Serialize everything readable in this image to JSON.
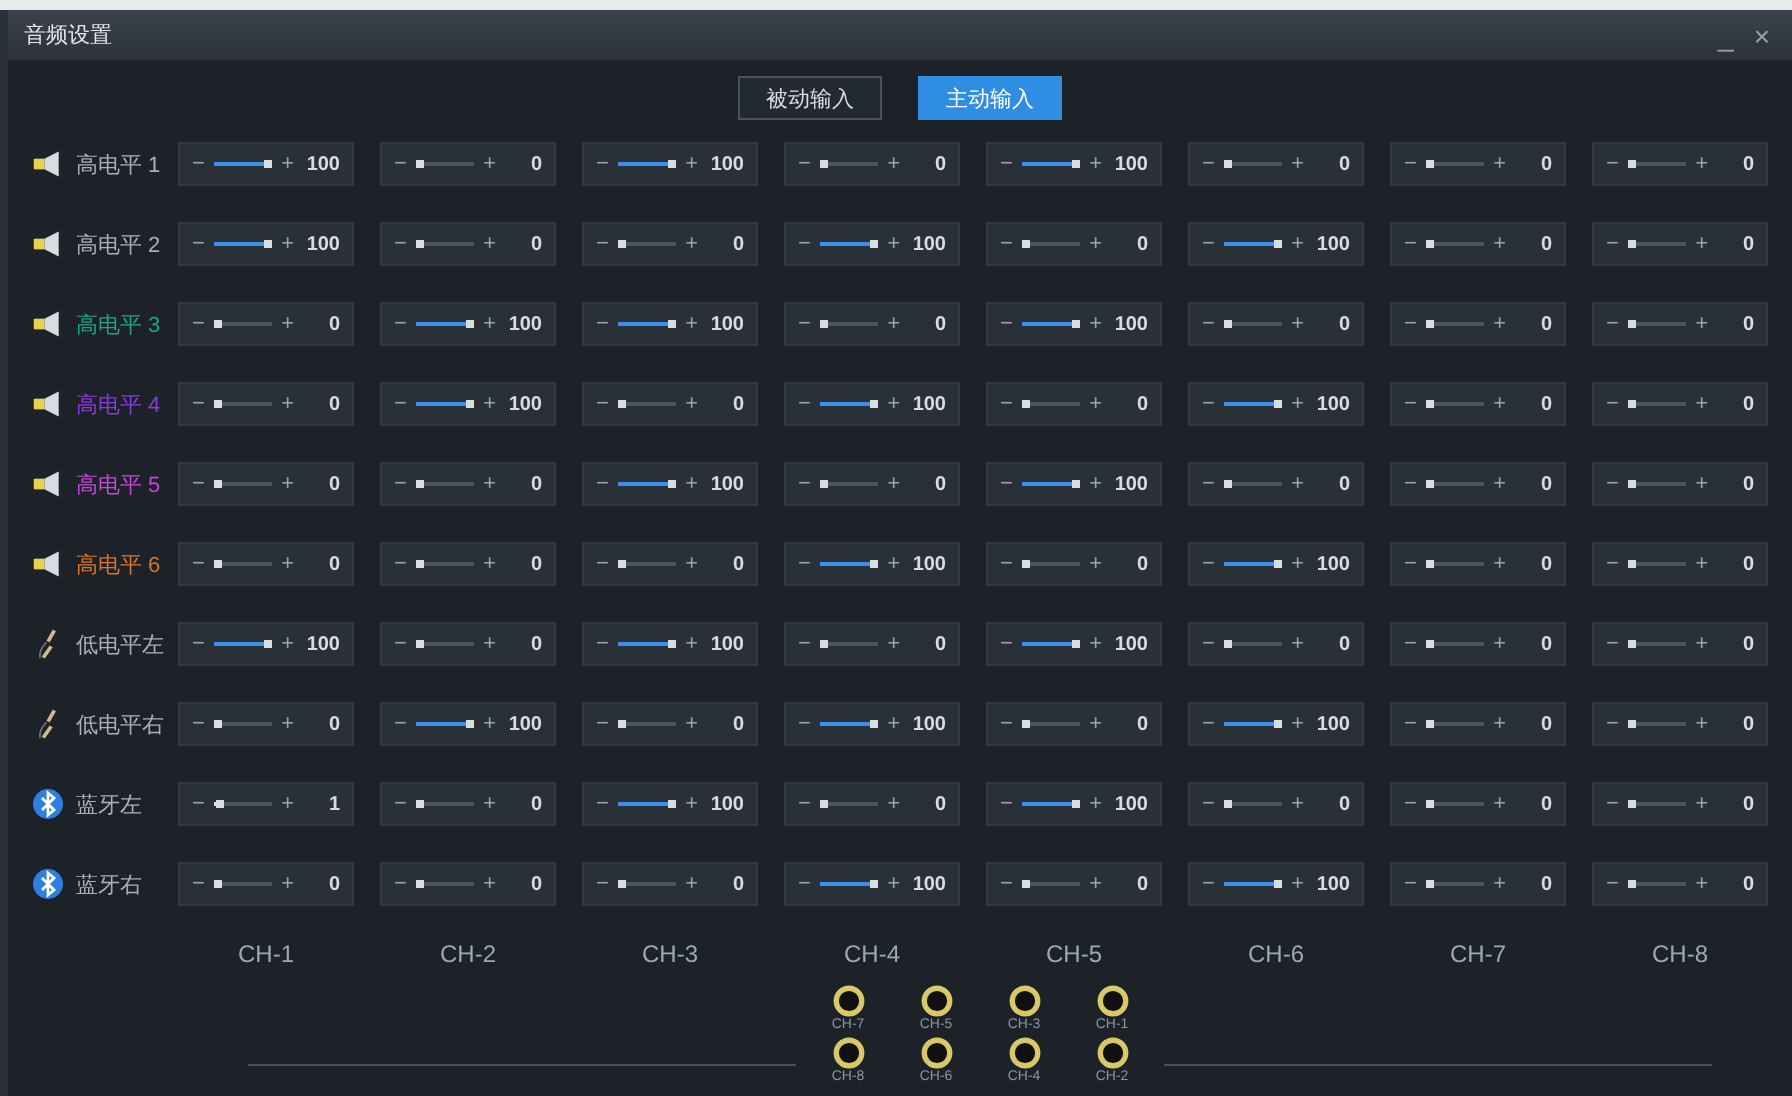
{
  "window": {
    "title": "音频设置",
    "controls": [
      "_",
      "×"
    ]
  },
  "modes": [
    {
      "label": "被动输入",
      "selected": false
    },
    {
      "label": "主动输入",
      "selected": true
    }
  ],
  "rows": [
    {
      "kind": "speaker",
      "label": "高电平 1",
      "color": "#a9b0b8",
      "cells": [
        {
          "level": 1,
          "reading": "100"
        },
        {
          "level": 0,
          "reading": "0"
        },
        {
          "level": 1,
          "reading": "100"
        },
        {
          "level": 0,
          "reading": "0"
        },
        {
          "level": 1,
          "reading": "100"
        },
        {
          "level": 0,
          "reading": "0"
        },
        {
          "level": 0,
          "reading": "0"
        },
        {
          "level": 0,
          "reading": "0"
        }
      ]
    },
    {
      "kind": "speaker",
      "label": "高电平 2",
      "color": "#a9b0b8",
      "cells": [
        {
          "level": 1,
          "reading": "100"
        },
        {
          "level": 0,
          "reading": "0"
        },
        {
          "level": 0,
          "reading": "0"
        },
        {
          "level": 1,
          "reading": "100"
        },
        {
          "level": 0,
          "reading": "0"
        },
        {
          "level": 1,
          "reading": "100"
        },
        {
          "level": 0,
          "reading": "0"
        },
        {
          "level": 0,
          "reading": "0"
        }
      ]
    },
    {
      "kind": "speaker",
      "label": "高电平 3",
      "color": "#1ea589",
      "cells": [
        {
          "level": 0,
          "reading": "0"
        },
        {
          "level": 1,
          "reading": "100"
        },
        {
          "level": 1,
          "reading": "100"
        },
        {
          "level": 0,
          "reading": "0"
        },
        {
          "level": 1,
          "reading": "100"
        },
        {
          "level": 0,
          "reading": "0"
        },
        {
          "level": 0,
          "reading": "0"
        },
        {
          "level": 0,
          "reading": "0"
        }
      ]
    },
    {
      "kind": "speaker",
      "label": "高电平 4",
      "color": "#8a3bd8",
      "cells": [
        {
          "level": 0,
          "reading": "0"
        },
        {
          "level": 1,
          "reading": "100"
        },
        {
          "level": 0,
          "reading": "0"
        },
        {
          "level": 1,
          "reading": "100"
        },
        {
          "level": 0,
          "reading": "0"
        },
        {
          "level": 1,
          "reading": "100"
        },
        {
          "level": 0,
          "reading": "0"
        },
        {
          "level": 0,
          "reading": "0"
        }
      ]
    },
    {
      "kind": "speaker",
      "label": "高电平 5",
      "color": "#c24bd6",
      "cells": [
        {
          "level": 0,
          "reading": "0"
        },
        {
          "level": 0,
          "reading": "0"
        },
        {
          "level": 1,
          "reading": "100"
        },
        {
          "level": 0,
          "reading": "0"
        },
        {
          "level": 1,
          "reading": "100"
        },
        {
          "level": 0,
          "reading": "0"
        },
        {
          "level": 0,
          "reading": "0"
        },
        {
          "level": 0,
          "reading": "0"
        }
      ]
    },
    {
      "kind": "speaker",
      "label": "高电平 6",
      "color": "#d8762c",
      "cells": [
        {
          "level": 0,
          "reading": "0"
        },
        {
          "level": 0,
          "reading": "0"
        },
        {
          "level": 0,
          "reading": "0"
        },
        {
          "level": 1,
          "reading": "100"
        },
        {
          "level": 0,
          "reading": "0"
        },
        {
          "level": 1,
          "reading": "100"
        },
        {
          "level": 0,
          "reading": "0"
        },
        {
          "level": 0,
          "reading": "0"
        }
      ]
    },
    {
      "kind": "cable",
      "label": "低电平左",
      "color": "#a9b0b8",
      "cells": [
        {
          "level": 1,
          "reading": "100"
        },
        {
          "level": 0,
          "reading": "0"
        },
        {
          "level": 1,
          "reading": "100"
        },
        {
          "level": 0,
          "reading": "0"
        },
        {
          "level": 1,
          "reading": "100"
        },
        {
          "level": 0,
          "reading": "0"
        },
        {
          "level": 0,
          "reading": "0"
        },
        {
          "level": 0,
          "reading": "0"
        }
      ]
    },
    {
      "kind": "cable",
      "label": "低电平右",
      "color": "#a9b0b8",
      "cells": [
        {
          "level": 0,
          "reading": "0"
        },
        {
          "level": 1,
          "reading": "100"
        },
        {
          "level": 0,
          "reading": "0"
        },
        {
          "level": 1,
          "reading": "100"
        },
        {
          "level": 0,
          "reading": "0"
        },
        {
          "level": 1,
          "reading": "100"
        },
        {
          "level": 0,
          "reading": "0"
        },
        {
          "level": 0,
          "reading": "0"
        }
      ]
    },
    {
      "kind": "bluetooth",
      "label": "蓝牙左",
      "color": "#a9b0b8",
      "cells": [
        {
          "level": 0.01,
          "reading": "1"
        },
        {
          "level": 0,
          "reading": "0"
        },
        {
          "level": 1,
          "reading": "100"
        },
        {
          "level": 0,
          "reading": "0"
        },
        {
          "level": 1,
          "reading": "100"
        },
        {
          "level": 0,
          "reading": "0"
        },
        {
          "level": 0,
          "reading": "0"
        },
        {
          "level": 0,
          "reading": "0"
        }
      ]
    },
    {
      "kind": "bluetooth",
      "label": "蓝牙右",
      "color": "#a9b0b8",
      "cells": [
        {
          "level": 0,
          "reading": "0"
        },
        {
          "level": 0,
          "reading": "0"
        },
        {
          "level": 0,
          "reading": "0"
        },
        {
          "level": 1,
          "reading": "100"
        },
        {
          "level": 0,
          "reading": "0"
        },
        {
          "level": 1,
          "reading": "100"
        },
        {
          "level": 0,
          "reading": "0"
        },
        {
          "level": 0,
          "reading": "0"
        }
      ]
    }
  ],
  "slider_signs": {
    "minus": "−",
    "plus": "+"
  },
  "channels": [
    "CH-1",
    "CH-2",
    "CH-3",
    "CH-4",
    "CH-5",
    "CH-6",
    "CH-7",
    "CH-8"
  ],
  "jacks": [
    [
      "CH-7",
      "CH-5",
      "CH-3",
      "CH-1"
    ],
    [
      "CH-8",
      "CH-6",
      "CH-4",
      "CH-2"
    ]
  ]
}
